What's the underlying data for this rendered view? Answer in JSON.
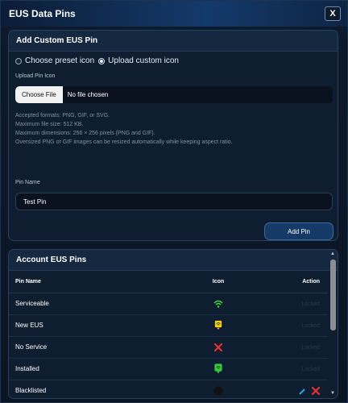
{
  "window": {
    "title": "EUS Data Pins",
    "close_label": "X"
  },
  "add_panel": {
    "header": "Add Custom EUS Pin",
    "radio_preset": "Choose preset icon",
    "radio_upload": "Upload custom icon",
    "selected": "upload",
    "upload_label": "Upload Pin Icon",
    "file_button": "Choose File",
    "file_status": "No file chosen",
    "help_lines": [
      "Accepted formats: PNG, GIF, or SVG.",
      "Maximum file size: 512 KB.",
      "Maximum dimensions: 256 × 256 pixels (PNG and GIF).",
      "Oversized PNG or GIF images can be resized automatically while keeping aspect ratio."
    ],
    "pin_name_label": "Pin Name",
    "pin_name_value": "Test Pin",
    "add_button": "Add Pin"
  },
  "list_panel": {
    "header": "Account EUS Pins",
    "columns": {
      "name": "Pin Name",
      "icon": "Icon",
      "action": "Action"
    },
    "rows": [
      {
        "name": "Serviceable",
        "icon": "wifi-icon",
        "icon_color": "#3ddc3d",
        "action": "Locked"
      },
      {
        "name": "New EUS",
        "icon": "yellow-pin-icon",
        "icon_color": "#f3d21a",
        "action": "Locked"
      },
      {
        "name": "No Service",
        "icon": "red-x-icon",
        "icon_color": "#e23333",
        "action": "Locked"
      },
      {
        "name": "Installed",
        "icon": "green-pin-icon",
        "icon_color": "#3ec43e",
        "action": "Locked"
      },
      {
        "name": "Blacklisted",
        "icon": "black-circle-icon",
        "icon_color": "#111111",
        "action": ""
      }
    ]
  },
  "colors": {
    "accent": "#163a66",
    "titlebar": "#143a6b",
    "panel_bg": "#0f1d30"
  }
}
